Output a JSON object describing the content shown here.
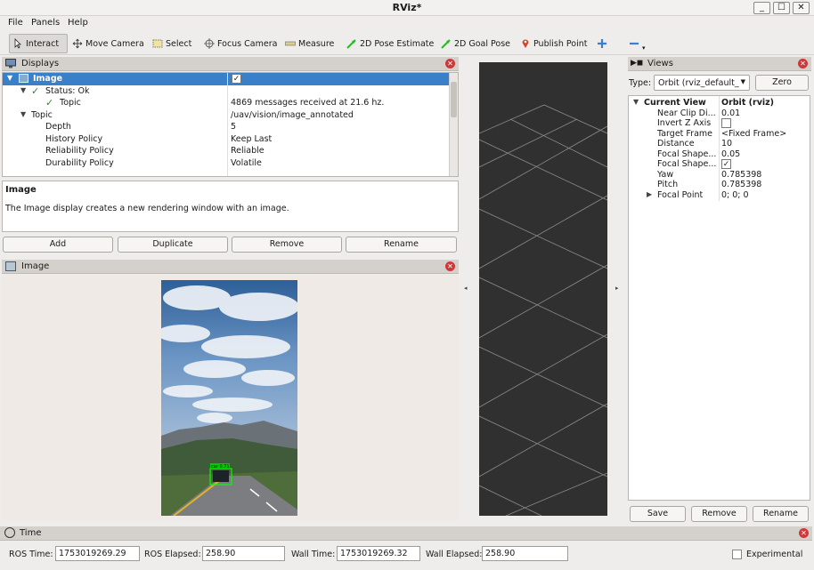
{
  "window": {
    "title": "RViz*",
    "min": "_",
    "max": "☐",
    "close": "✕"
  },
  "menu": [
    "File",
    "Panels",
    "Help"
  ],
  "toolbar": [
    {
      "label": "Interact",
      "icon": "cursor-icon",
      "active": true
    },
    {
      "label": "Move Camera",
      "icon": "move-camera-icon"
    },
    {
      "label": "Select",
      "icon": "select-icon"
    },
    {
      "label": "Focus Camera",
      "icon": "focus-camera-icon"
    },
    {
      "label": "Measure",
      "icon": "measure-icon"
    },
    {
      "label": "2D Pose Estimate",
      "icon": "pose-estimate-icon"
    },
    {
      "label": "2D Goal Pose",
      "icon": "goal-pose-icon"
    },
    {
      "label": "Publish Point",
      "icon": "publish-point-icon"
    }
  ],
  "displays": {
    "title": "Displays",
    "rows": [
      {
        "key": "Image",
        "value": "✓"
      },
      {
        "key": "Status: Ok",
        "value": ""
      },
      {
        "key": "Topic",
        "value": "4869 messages received at 21.6 hz."
      },
      {
        "key": "Topic",
        "value": "/uav/vision/image_annotated"
      },
      {
        "key": "Depth",
        "value": "5"
      },
      {
        "key": "History Policy",
        "value": "Keep Last"
      },
      {
        "key": "Reliability Policy",
        "value": "Reliable"
      },
      {
        "key": "Durability Policy",
        "value": "Volatile"
      }
    ],
    "desc_title": "Image",
    "desc_text": "The Image display creates a new rendering window with an image.",
    "buttons": [
      "Add",
      "Duplicate",
      "Remove",
      "Rename"
    ]
  },
  "image_panel": {
    "title": "Image",
    "detection_label": "car 0.71"
  },
  "views": {
    "title": "Views",
    "type_label": "Type:",
    "type_value": "Orbit (rviz_default_",
    "zero": "Zero",
    "rows": [
      {
        "key": "Current View",
        "value": "Orbit (rviz)"
      },
      {
        "key": "Near Clip Di...",
        "value": "0.01"
      },
      {
        "key": "Invert Z Axis",
        "value": ""
      },
      {
        "key": "Target Frame",
        "value": "<Fixed Frame>"
      },
      {
        "key": "Distance",
        "value": "10"
      },
      {
        "key": "Focal Shape...",
        "value": "0.05"
      },
      {
        "key": "Focal Shape...",
        "value": "✓"
      },
      {
        "key": "Yaw",
        "value": "0.785398"
      },
      {
        "key": "Pitch",
        "value": "0.785398"
      },
      {
        "key": "Focal Point",
        "value": "0; 0; 0"
      }
    ],
    "buttons": [
      "Save",
      "Remove",
      "Rename"
    ]
  },
  "time": {
    "title": "Time",
    "ros_time_label": "ROS Time:",
    "ros_time": "1753019269.29",
    "ros_elapsed_label": "ROS Elapsed:",
    "ros_elapsed": "258.90",
    "wall_time_label": "Wall Time:",
    "wall_time": "1753019269.32",
    "wall_elapsed_label": "Wall Elapsed:",
    "wall_elapsed": "258.90",
    "experimental": "Experimental"
  }
}
